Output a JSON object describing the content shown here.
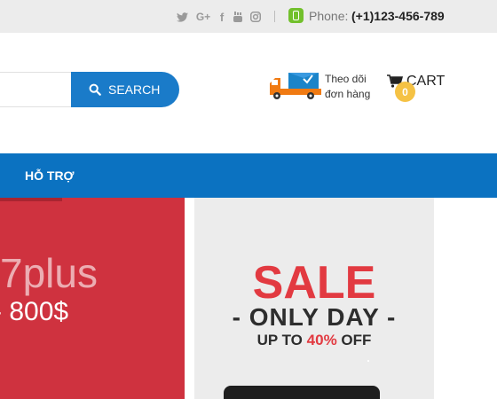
{
  "topbar": {
    "social_icons": [
      "twitter-icon",
      "google-plus-icon",
      "facebook-icon",
      "youtube-icon",
      "instagram-icon"
    ],
    "social_glyphs": {
      "google_plus": "G+",
      "facebook": "f"
    },
    "phone_label": "Phone:",
    "phone_number": "(+1)123-456-789"
  },
  "header": {
    "search": {
      "value": "",
      "placeholder": "",
      "button_label": "SEARCH"
    },
    "tracking": {
      "line1": "Theo dõi",
      "line2": "đơn hàng"
    },
    "cart": {
      "label": "CART",
      "count": "0"
    }
  },
  "nav": {
    "items": [
      {
        "label": "HỖ TRỢ"
      }
    ]
  },
  "banners": {
    "left": {
      "model": "7plus",
      "price": "- 800$"
    },
    "right": {
      "title": "SALE",
      "subtitle": "- ONLY DAY -",
      "offer_prefix": "UP TO",
      "offer_percent": "40%",
      "offer_suffix": "OFF"
    }
  },
  "colors": {
    "topbar_bg": "#ececec",
    "accent_blue": "#0b72c1",
    "search_blue": "#1a7bc9",
    "phone_green": "#72c02c",
    "cart_badge": "#f5c244",
    "sale_red": "#e23a41",
    "banner_red": "#cf323f"
  }
}
